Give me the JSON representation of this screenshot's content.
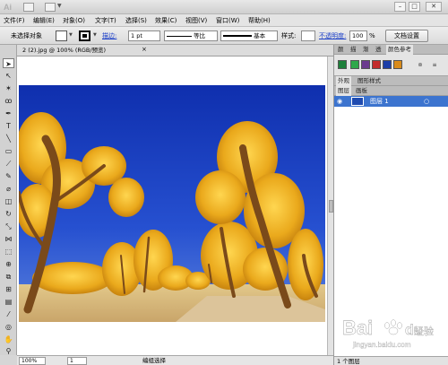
{
  "app": {
    "logo": "Ai"
  },
  "menu": [
    "文件(F)",
    "编辑(E)",
    "对象(O)",
    "文字(T)",
    "选择(S)",
    "效果(C)",
    "视图(V)",
    "窗口(W)",
    "帮助(H)"
  ],
  "control_bar": {
    "selection_label": "未选择对象",
    "stroke_label": "描边:",
    "stroke_weight": "1 pt",
    "stroke_profile": "等比",
    "brush": "基本",
    "style_label": "样式:",
    "opacity_label": "不透明度:",
    "opacity_value": "100",
    "opacity_unit": "%",
    "doc_settings_button": "文档设置"
  },
  "document": {
    "tab_title": "2 (2).jpg @ 100% (RGB/预览)",
    "close": "×"
  },
  "status": {
    "zoom": "100%",
    "page": "1",
    "tool_status": "编组选择"
  },
  "panels": {
    "top_tabs": [
      "颜",
      "描",
      "渐",
      "透",
      "颜色参考"
    ],
    "top_active": 4,
    "appearance_tabs": [
      "外观",
      "图形样式"
    ],
    "layer_tabs": [
      "图层",
      "画板"
    ],
    "layer_name": "图层 1",
    "layer_count": "1 个图层"
  },
  "colors": {
    "sky": "#1b3fb8",
    "foliage": "#e8a91a",
    "selection": "#3c74cf"
  },
  "watermark": {
    "brand": "Bai",
    "paw": "du",
    "cn": "经验",
    "url": "jingyan.baidu.com"
  }
}
